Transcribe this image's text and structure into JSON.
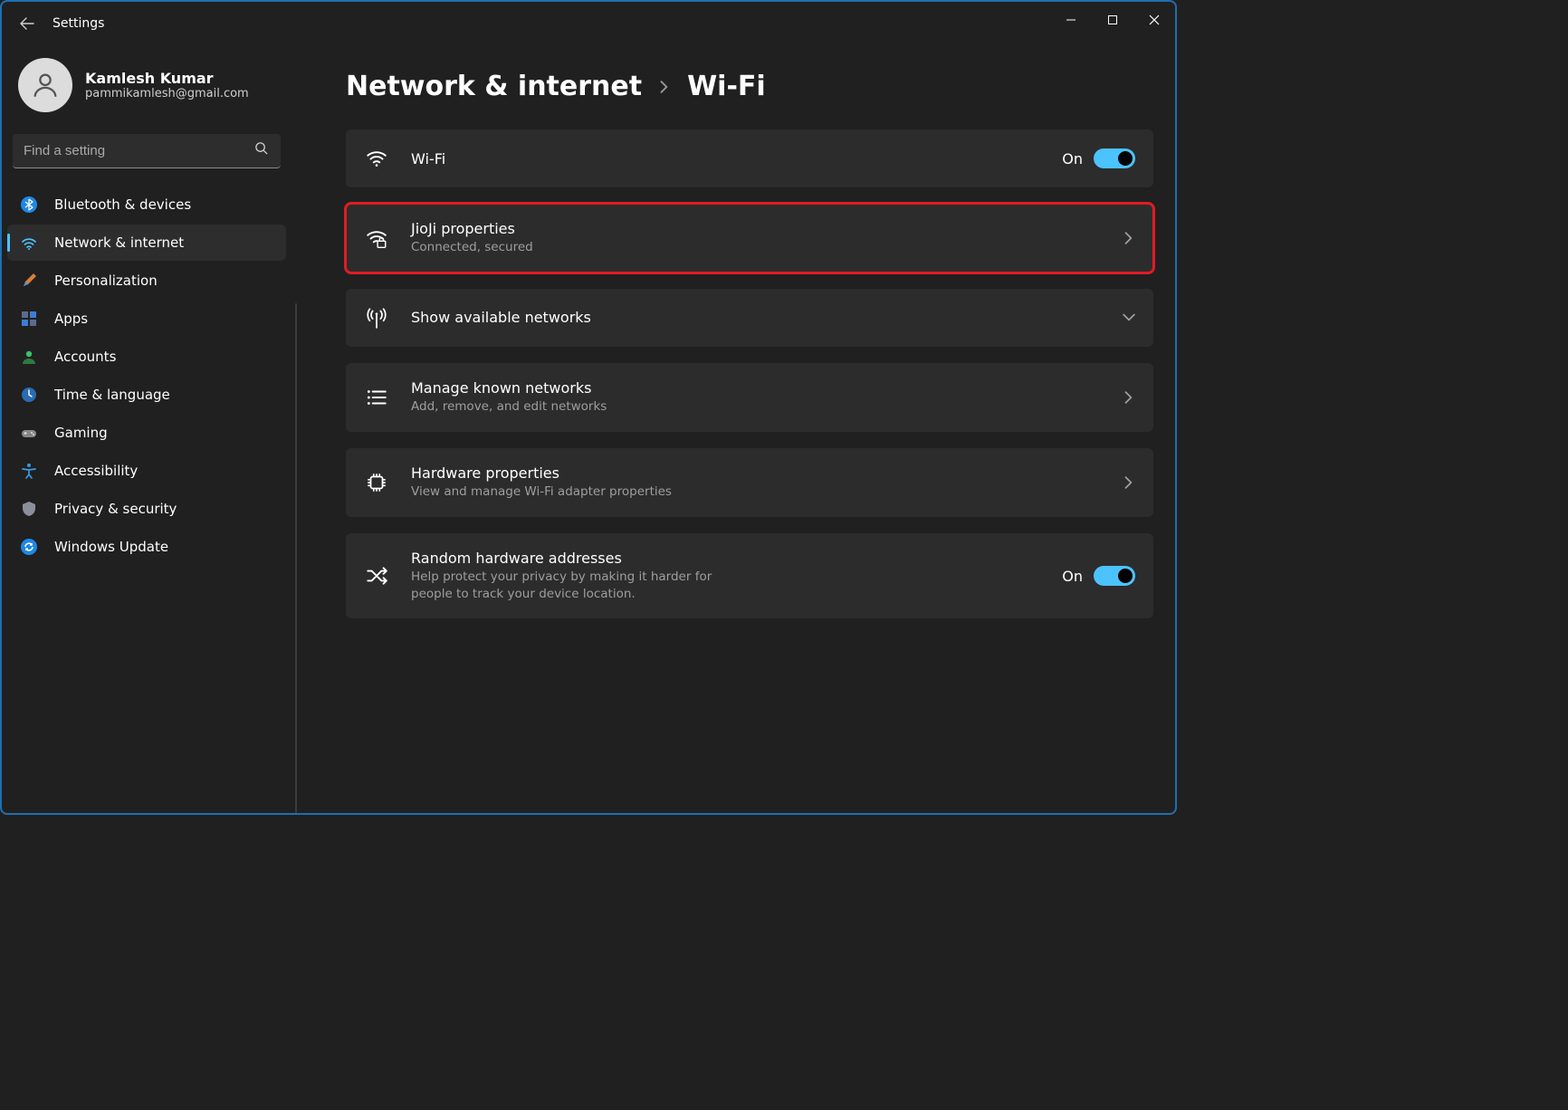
{
  "window": {
    "title": "Settings"
  },
  "profile": {
    "name": "Kamlesh Kumar",
    "email": "pammikamlesh@gmail.com"
  },
  "search": {
    "placeholder": "Find a setting"
  },
  "sidebar": {
    "items": [
      {
        "label": "Bluetooth & devices"
      },
      {
        "label": "Network & internet"
      },
      {
        "label": "Personalization"
      },
      {
        "label": "Apps"
      },
      {
        "label": "Accounts"
      },
      {
        "label": "Time & language"
      },
      {
        "label": "Gaming"
      },
      {
        "label": "Accessibility"
      },
      {
        "label": "Privacy & security"
      },
      {
        "label": "Windows Update"
      }
    ],
    "active_index": 1
  },
  "breadcrumb": {
    "parent": "Network & internet",
    "current": "Wi-Fi"
  },
  "cards": {
    "wifi": {
      "title": "Wi-Fi",
      "state_label": "On"
    },
    "props": {
      "title": "JioJi properties",
      "sub": "Connected, secured"
    },
    "avail": {
      "title": "Show available networks"
    },
    "known": {
      "title": "Manage known networks",
      "sub": "Add, remove, and edit networks"
    },
    "hw": {
      "title": "Hardware properties",
      "sub": "View and manage Wi-Fi adapter properties"
    },
    "rand": {
      "title": "Random hardware addresses",
      "sub": "Help protect your privacy by making it harder for people to track your device location.",
      "state_label": "On"
    }
  }
}
